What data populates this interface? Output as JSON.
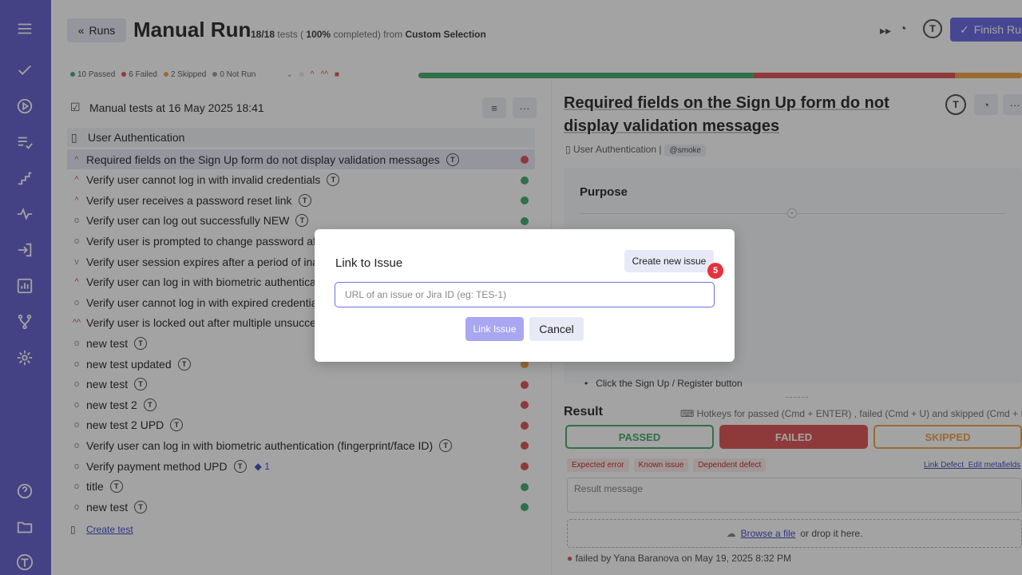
{
  "header": {
    "back_label": "Runs",
    "title": "Manual Run",
    "progress_count": "18/18",
    "progress_tests_word": "tests (",
    "progress_pct": "100%",
    "progress_completed": "completed) from",
    "selection": "Custom Selection",
    "finish_label": "Finish Run"
  },
  "stats": {
    "passed": "10 Passed",
    "failed": "6 Failed",
    "skipped": "2 Skipped",
    "notrun": "0 Not Run"
  },
  "progress": {
    "passed": 10,
    "failed": 6,
    "skipped": 2,
    "total": 18
  },
  "colors": {
    "passed": "#4caf73",
    "failed": "#e05b5b",
    "skipped": "#f0a84b",
    "notrun": "#9e9e9e",
    "accent": "#6f6ee6",
    "sidebar": "#6b68cf"
  },
  "suite": {
    "title": "Manual tests at 16 May 2025 18:41",
    "group": "User Authentication"
  },
  "tests": [
    {
      "pri": "^",
      "name": "Required fields on the Sign Up form do not display validation messages",
      "status": "failed",
      "selected": true
    },
    {
      "pri": "^",
      "name": "Verify user cannot log in with invalid credentials",
      "status": "passed"
    },
    {
      "pri": "^",
      "name": "Verify user receives a password reset link",
      "status": "passed"
    },
    {
      "pri": "o",
      "name": "Verify user can log out successfully NEW",
      "status": "passed"
    },
    {
      "pri": "o",
      "name": "Verify user is prompted to change password aft",
      "status": "failed"
    },
    {
      "pri": "v",
      "name": "Verify user session expires after a period of inac",
      "status": "failed"
    },
    {
      "pri": "^",
      "name": "Verify user can log in with biometric authenticat",
      "status": "passed"
    },
    {
      "pri": "o",
      "name": "Verify user cannot log in with expired credentia",
      "status": "passed"
    },
    {
      "pri": "^^",
      "name": "Verify user is locked out after multiple unsucce",
      "status": "failed"
    },
    {
      "pri": "o",
      "name": "new test",
      "status": "passed"
    },
    {
      "pri": "o",
      "name": "new test updated",
      "status": "skipped"
    },
    {
      "pri": "o",
      "name": "new test",
      "status": "failed"
    },
    {
      "pri": "o",
      "name": "new test 2",
      "status": "failed"
    },
    {
      "pri": "o",
      "name": "new test 2 UPD",
      "status": "failed"
    },
    {
      "pri": "o",
      "name": "Verify user can log in with biometric authentication (fingerprint/face ID)",
      "status": "failed"
    },
    {
      "pri": "o",
      "name": "Verify payment method UPD",
      "status": "failed",
      "extra": "1"
    },
    {
      "pri": "o",
      "name": "title",
      "status": "passed"
    },
    {
      "pri": "o",
      "name": "new test",
      "status": "passed"
    }
  ],
  "create_test": "Create test",
  "detail": {
    "title": "Required fields on the Sign Up form do not display validation messages",
    "crumb": "User Authentication |",
    "tag": "@smoke",
    "purpose": "Purpose",
    "bullet": "Click the Sign Up / Register button",
    "result": "Result",
    "hotkeys": "Hotkeys for passed (Cmd + ENTER) , failed (Cmd + U) and skipped (Cmd + I)",
    "passed_btn": "PASSED",
    "failed_btn": "FAILED",
    "skipped_btn": "SKIPPED",
    "tags": [
      "Expected error",
      "Known issue",
      "Dependent defect"
    ],
    "link_defect": "Link Defect",
    "edit_meta": "Edit metafields",
    "result_placeholder": "Result message",
    "browse": "Browse a file",
    "drop": "or drop it here.",
    "failed_line": "failed by Yana Baranova on May 19, 2025 8:32 PM"
  },
  "modal": {
    "title": "Link to Issue",
    "create_label": "Create new issue",
    "badge": "5",
    "placeholder": "URL of an issue or Jira ID (eg: TES-1)",
    "link_label": "Link Issue",
    "cancel_label": "Cancel"
  }
}
